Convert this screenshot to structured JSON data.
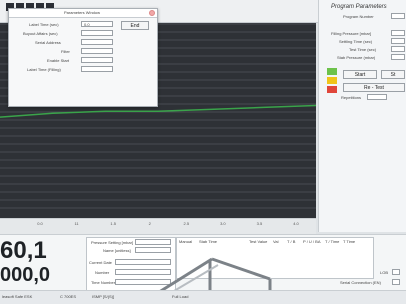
{
  "modal": {
    "title": "Parameters Window",
    "fields": [
      {
        "label": "Label Time (sec)",
        "value": "0.0"
      },
      {
        "label": "Buyout Affairs (sec)",
        "value": ""
      },
      {
        "label": "Serial Address",
        "value": ""
      },
      {
        "label": "Filter",
        "value": ""
      },
      {
        "label": "Enable Start",
        "value": ""
      },
      {
        "label": "Label Time (Filling)",
        "value": ""
      }
    ],
    "button_label": "End"
  },
  "right_panel": {
    "title": "Program Parameters",
    "rows": [
      {
        "label": "Program Number",
        "value": ""
      },
      {
        "label": "Filling Pressure [mbar]",
        "value": ""
      },
      {
        "label": "Settling Time (sec)",
        "value": ""
      },
      {
        "label": "Test Time (sec)",
        "value": ""
      },
      {
        "label": "Stab Pressure (mbar)",
        "value": ""
      }
    ],
    "start_label": "Start",
    "stop_label": "St",
    "retest_label": "Re - Test",
    "repetitions_label": "Repetitions",
    "status_colors": [
      "#6dc24b",
      "#f0c419",
      "#e0463a"
    ]
  },
  "chart_data": {
    "type": "line",
    "x_ticks": [
      "0.0",
      "11",
      "1.5",
      "2",
      "2.5",
      "3.0",
      "3.5",
      "4.0"
    ],
    "xlabel": "",
    "series": [
      {
        "values": [
          0.52,
          0.54,
          0.55,
          0.55,
          0.56,
          0.57,
          0.58
        ]
      }
    ],
    "grid": true,
    "ylim": [
      0,
      1
    ]
  },
  "bottom": {
    "big_value_1": "60,1",
    "big_value_2": "000,0",
    "form_labels": [
      "Pressure Setting [mbar]",
      "Name [unitless]",
      "Current Date",
      "Number",
      "Time Number"
    ],
    "table_headers": [
      "Manual",
      "Stab Time",
      "Test Value",
      "Val",
      "T / B",
      "P / U / BA",
      "T / Time",
      "T Time"
    ],
    "status_items": [
      "leasoft Safe ESK",
      "C 700ES",
      "ISMP [S/(S)]",
      "Full Load"
    ],
    "unit_label": "LOB",
    "serial_label": "Serial Connection (EN)"
  },
  "toolbar": {
    "icon_count": 5
  }
}
